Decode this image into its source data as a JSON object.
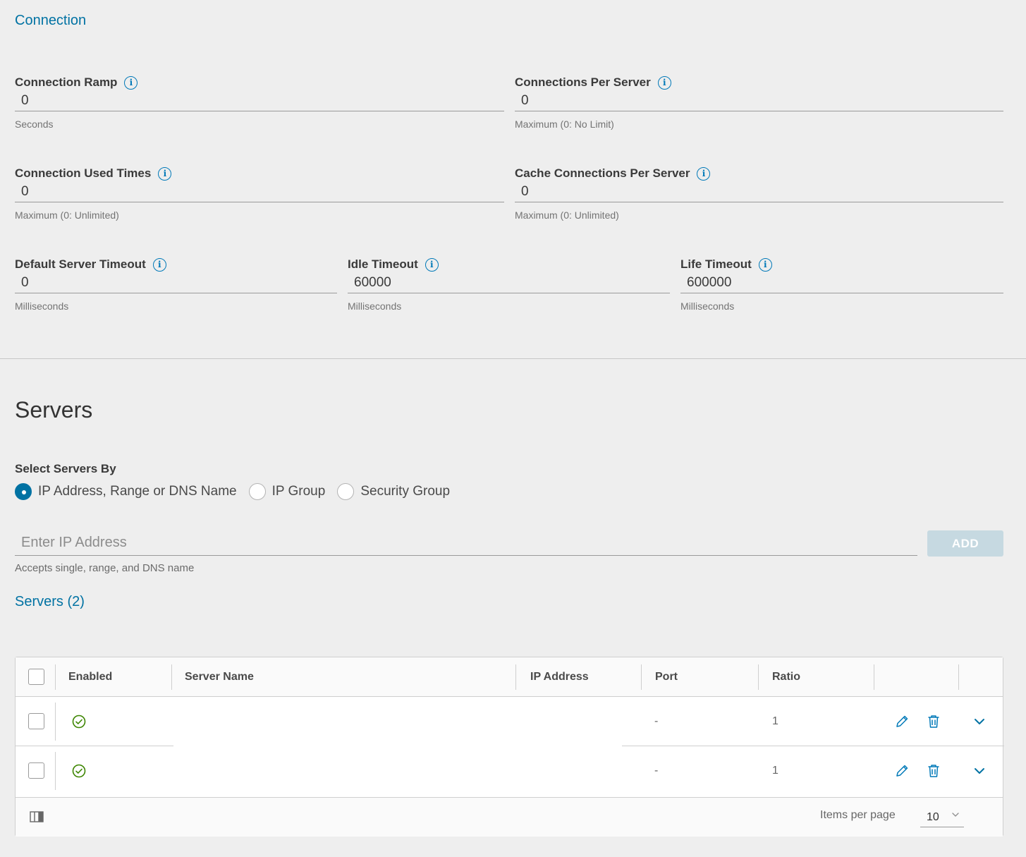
{
  "connection": {
    "title": "Connection",
    "fields": {
      "connection_ramp": {
        "label": "Connection Ramp",
        "value": "0",
        "help": "Seconds"
      },
      "connections_per_server": {
        "label": "Connections Per Server",
        "value": "0",
        "help": "Maximum (0: No Limit)"
      },
      "connection_used_times": {
        "label": "Connection Used Times",
        "value": "0",
        "help": "Maximum (0: Unlimited)"
      },
      "cache_connections_per_server": {
        "label": "Cache Connections Per Server",
        "value": "0",
        "help": "Maximum (0: Unlimited)"
      },
      "default_server_timeout": {
        "label": "Default Server Timeout",
        "value": "0",
        "help": "Milliseconds"
      },
      "idle_timeout": {
        "label": "Idle Timeout",
        "value": "60000",
        "help": "Milliseconds"
      },
      "life_timeout": {
        "label": "Life Timeout",
        "value": "600000",
        "help": "Milliseconds"
      }
    },
    "info_glyph": "i"
  },
  "servers": {
    "title": "Servers",
    "select_by": {
      "label": "Select Servers By",
      "options": [
        "IP Address, Range or DNS Name",
        "IP Group",
        "Security Group"
      ],
      "selected": "IP Address, Range or DNS Name"
    },
    "ip_input": {
      "placeholder": "Enter IP Address",
      "help": "Accepts single, range, and DNS name"
    },
    "add_label": "ADD",
    "list_link": "Servers (2)",
    "table": {
      "columns": [
        "Enabled",
        "Server Name",
        "IP Address",
        "Port",
        "Ratio"
      ],
      "rows": [
        {
          "enabled": "enabled-check-icon",
          "server_name": "",
          "ip_address": "",
          "port": "-",
          "ratio": "1"
        },
        {
          "enabled": "enabled-check-icon",
          "server_name": "",
          "ip_address": "",
          "port": "-",
          "ratio": "1"
        }
      ],
      "footer": {
        "items_per_page_label": "Items per page",
        "items_per_page_value": "10"
      }
    }
  },
  "colors": {
    "accent": "#0072a3",
    "success": "#3c8500",
    "background": "#eeeeee",
    "add_disabled": "#c6d9e1"
  }
}
